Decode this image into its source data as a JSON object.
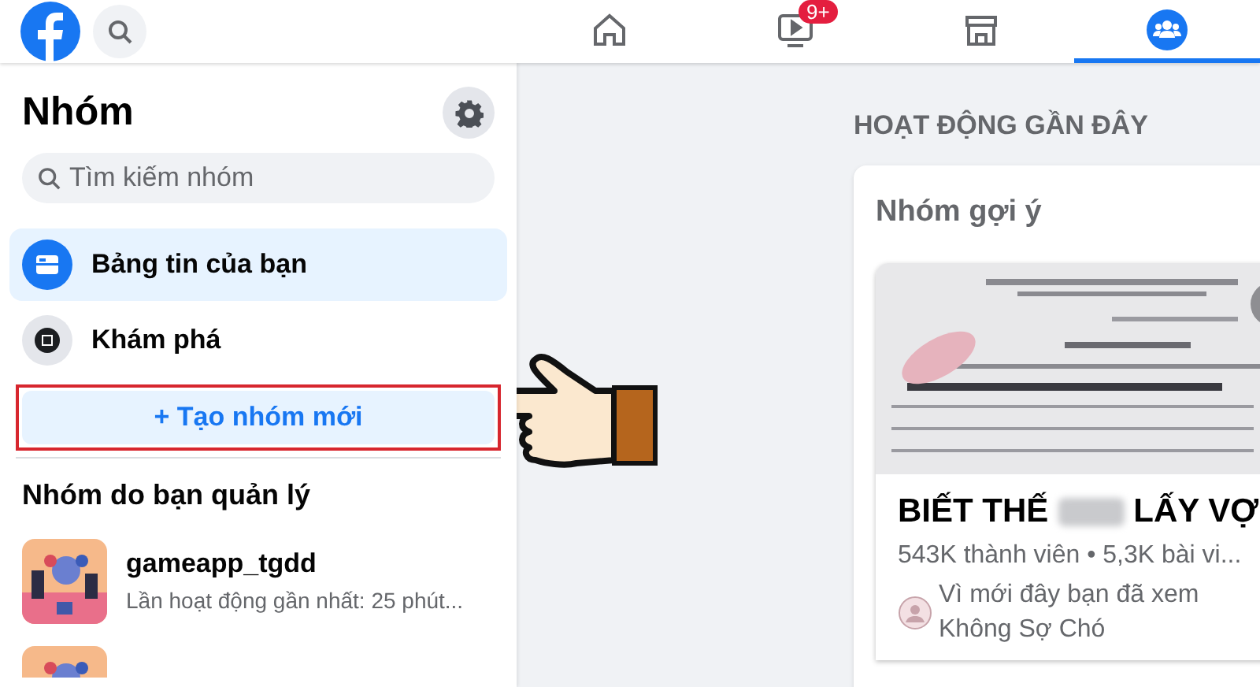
{
  "top_bar": {
    "tabs": [
      {
        "kind": "home",
        "selected": false
      },
      {
        "kind": "video",
        "selected": false,
        "badge": "9+"
      },
      {
        "kind": "store",
        "selected": false
      },
      {
        "kind": "groups",
        "selected": true
      }
    ]
  },
  "sidebar": {
    "title": "Nhóm",
    "search": {
      "placeholder": "Tìm kiếm nhóm"
    },
    "items": [
      {
        "kind": "feed",
        "label": "Bảng tin của bạn",
        "selected": true
      },
      {
        "kind": "explore",
        "label": "Khám phá",
        "selected": false
      }
    ],
    "create_button": "+ Tạo nhóm mới",
    "section_title": "Nhóm do bạn quản lý",
    "groups": [
      {
        "name": "gameapp_tgdd",
        "subtitle": "Lần hoạt động gần nhất: 25 phút..."
      }
    ]
  },
  "main": {
    "heading": "HOẠT ĐỘNG GẦN ĐÂY",
    "card": {
      "title": "Nhóm gợi ý",
      "suggestion": {
        "name_start": "BIẾT THẾ",
        "name_end": "LẤY VỢ",
        "stats": "543K thành viên • 5,3K bài vi...",
        "reason": [
          "Vì mới đây bạn đã xem",
          "Không Sợ Chó"
        ]
      }
    }
  }
}
